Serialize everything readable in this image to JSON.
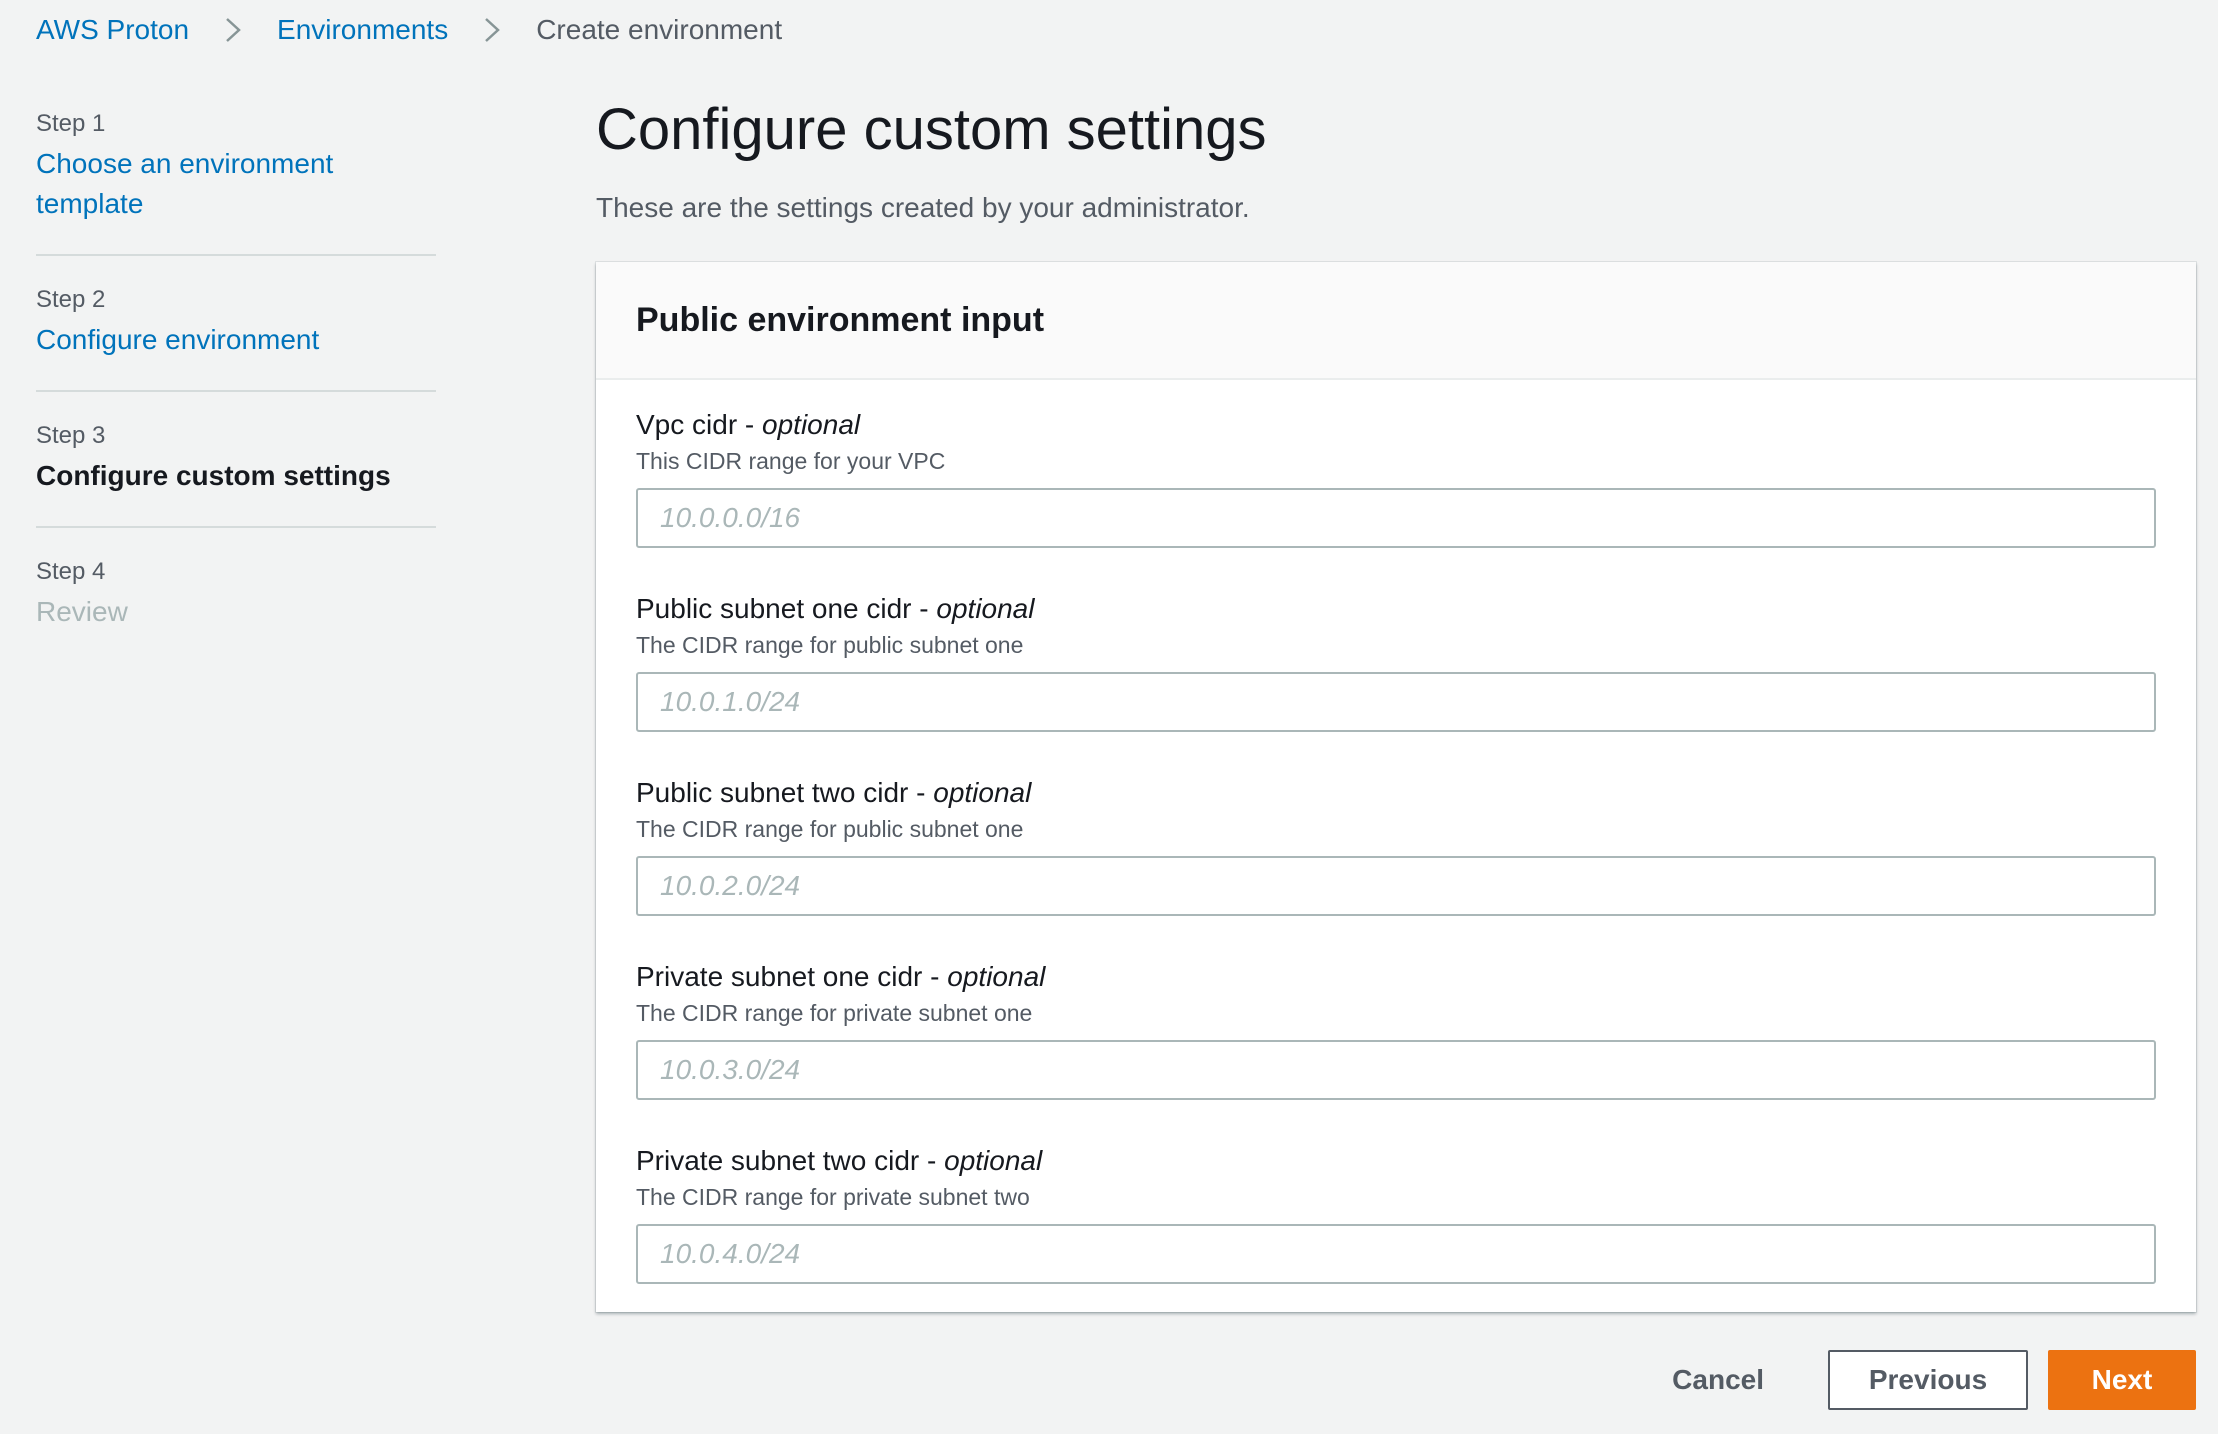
{
  "breadcrumb": {
    "items": [
      {
        "label": "AWS Proton"
      },
      {
        "label": "Environments"
      },
      {
        "label": "Create environment"
      }
    ]
  },
  "wizard": {
    "steps": [
      {
        "step": "Step 1",
        "title": "Choose an environment template",
        "state": "link"
      },
      {
        "step": "Step 2",
        "title": "Configure environment",
        "state": "link"
      },
      {
        "step": "Step 3",
        "title": "Configure custom settings",
        "state": "current"
      },
      {
        "step": "Step 4",
        "title": "Review",
        "state": "disabled"
      }
    ]
  },
  "main": {
    "title": "Configure custom settings",
    "description": "These are the settings created by your administrator."
  },
  "panel": {
    "title": "Public environment input",
    "optional_suffix": "optional",
    "fields": [
      {
        "label": "Vpc cidr - ",
        "description": "This CIDR range for your VPC",
        "placeholder": "10.0.0.0/16",
        "value": ""
      },
      {
        "label": "Public subnet one cidr - ",
        "description": "The CIDR range for public subnet one",
        "placeholder": "10.0.1.0/24",
        "value": ""
      },
      {
        "label": "Public subnet two cidr - ",
        "description": "The CIDR range for public subnet one",
        "placeholder": "10.0.2.0/24",
        "value": ""
      },
      {
        "label": "Private subnet one cidr - ",
        "description": "The CIDR range for private subnet one",
        "placeholder": "10.0.3.0/24",
        "value": ""
      },
      {
        "label": "Private subnet two cidr - ",
        "description": "The CIDR range for private subnet two",
        "placeholder": "10.0.4.0/24",
        "value": ""
      }
    ]
  },
  "actions": {
    "cancel_label": "Cancel",
    "previous_label": "Previous",
    "next_label": "Next"
  },
  "colors": {
    "link": "#0073bb",
    "primary_button": "#ec7211",
    "background": "#f2f3f3",
    "muted_text": "#545b64",
    "disabled_text": "#aab7b8"
  },
  "icons": {
    "breadcrumb_separator": "chevron-right-icon"
  }
}
